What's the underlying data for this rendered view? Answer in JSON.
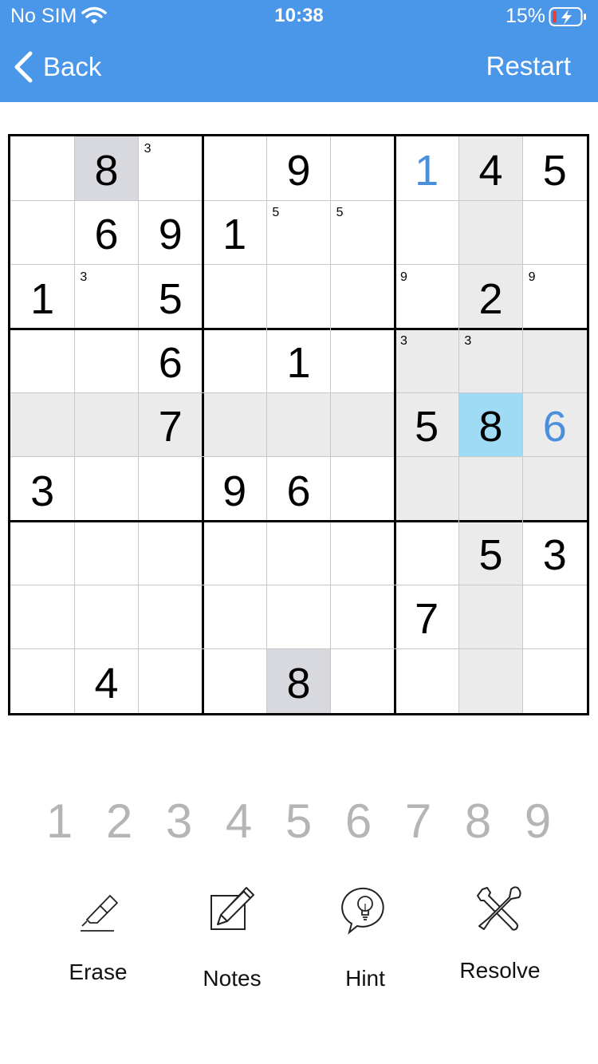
{
  "status_bar": {
    "carrier": "No SIM",
    "time": "10:38",
    "battery": "15%"
  },
  "nav": {
    "back_label": "Back",
    "restart_label": "Restart",
    "bar_color": "#4a96e8"
  },
  "board": {
    "selected_cell": [
      4,
      7
    ],
    "rows": [
      [
        {
          "v": ""
        },
        {
          "v": "8",
          "hl": "same"
        },
        {
          "note": "3"
        },
        {
          "v": ""
        },
        {
          "v": "9"
        },
        {
          "v": ""
        },
        {
          "v": "1",
          "user": true
        },
        {
          "v": "4"
        },
        {
          "v": "5"
        }
      ],
      [
        {
          "v": ""
        },
        {
          "v": "6"
        },
        {
          "v": "9"
        },
        {
          "v": "1"
        },
        {
          "note": "5"
        },
        {
          "note": "5"
        },
        {
          "v": ""
        },
        {
          "v": ""
        },
        {
          "v": ""
        }
      ],
      [
        {
          "v": "1"
        },
        {
          "note": "3"
        },
        {
          "v": "5"
        },
        {
          "v": ""
        },
        {
          "v": ""
        },
        {
          "v": ""
        },
        {
          "note": "9"
        },
        {
          "v": "2"
        },
        {
          "note": "9"
        }
      ],
      [
        {
          "v": ""
        },
        {
          "v": ""
        },
        {
          "v": "6"
        },
        {
          "v": ""
        },
        {
          "v": "1"
        },
        {
          "v": ""
        },
        {
          "note": "3"
        },
        {
          "note": "3"
        },
        {
          "v": ""
        }
      ],
      [
        {
          "v": ""
        },
        {
          "v": ""
        },
        {
          "v": "7"
        },
        {
          "v": ""
        },
        {
          "v": ""
        },
        {
          "v": ""
        },
        {
          "v": "5"
        },
        {
          "v": "8"
        },
        {
          "v": "6",
          "user": true
        }
      ],
      [
        {
          "v": "3"
        },
        {
          "v": ""
        },
        {
          "v": ""
        },
        {
          "v": "9"
        },
        {
          "v": "6"
        },
        {
          "v": ""
        },
        {
          "v": ""
        },
        {
          "v": ""
        },
        {
          "v": ""
        }
      ],
      [
        {
          "v": ""
        },
        {
          "v": ""
        },
        {
          "v": ""
        },
        {
          "v": ""
        },
        {
          "v": ""
        },
        {
          "v": ""
        },
        {
          "v": ""
        },
        {
          "v": "5"
        },
        {
          "v": "3"
        }
      ],
      [
        {
          "v": ""
        },
        {
          "v": ""
        },
        {
          "v": ""
        },
        {
          "v": ""
        },
        {
          "v": ""
        },
        {
          "v": ""
        },
        {
          "v": "7"
        },
        {
          "v": ""
        },
        {
          "v": ""
        }
      ],
      [
        {
          "v": ""
        },
        {
          "v": "4"
        },
        {
          "v": ""
        },
        {
          "v": ""
        },
        {
          "v": "8",
          "hl": "same"
        },
        {
          "v": ""
        },
        {
          "v": ""
        },
        {
          "v": ""
        },
        {
          "v": ""
        }
      ]
    ]
  },
  "numpad": [
    "1",
    "2",
    "3",
    "4",
    "5",
    "6",
    "7",
    "8",
    "9"
  ],
  "tools": {
    "erase": {
      "label": "Erase",
      "icon": "eraser-icon"
    },
    "notes": {
      "label": "Notes",
      "icon": "pencil-notes-icon"
    },
    "hint": {
      "label": "Hint",
      "icon": "lightbulb-bubble-icon"
    },
    "resolve": {
      "label": "Resolve",
      "icon": "wrench-screwdriver-icon"
    }
  },
  "colors": {
    "user_digit": "#4a8fdc",
    "selected_cell": "#a0dbf5",
    "peer_highlight": "#ebebeb",
    "same_value_highlight": "#d8d9df",
    "numpad_digit": "#b5b5b5"
  }
}
